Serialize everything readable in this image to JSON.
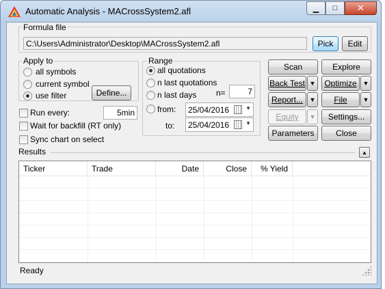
{
  "window": {
    "title": "Automatic Analysis - MACrossSystem2.afl"
  },
  "formula": {
    "group_label": "Formula file",
    "path": "C:\\Users\\Administrator\\Desktop\\MACrossSystem2.afl",
    "pick_label": "Pick",
    "edit_label": "Edit"
  },
  "apply_to": {
    "group_label": "Apply to",
    "options": [
      "all symbols",
      "current symbol",
      "use filter"
    ],
    "selected": "use filter",
    "define_label": "Define..."
  },
  "range": {
    "group_label": "Range",
    "options": [
      "all quotations",
      "n last quotations",
      "n last days",
      "from:"
    ],
    "selected": "all quotations",
    "n_label": "n=",
    "n_value": "7",
    "to_label": "to:",
    "from_date": "25/04/2016",
    "to_date": "25/04/2016"
  },
  "options": {
    "run_every_label": "Run every:",
    "run_every_value": "5min",
    "wait_backfill_label": "Wait for backfill (RT only)",
    "sync_chart_label": "Sync chart on select"
  },
  "actions": {
    "scan": "Scan",
    "explore": "Explore",
    "back_test": "Back Test",
    "optimize": "Optimize",
    "report": "Report...",
    "file": "File",
    "equity": "Equity",
    "settings": "Settings...",
    "parameters": "Parameters",
    "close": "Close"
  },
  "results": {
    "label": "Results",
    "columns": [
      "Ticker",
      "Trade",
      "Date",
      "Close",
      "% Yield"
    ]
  },
  "status": {
    "text": "Ready"
  },
  "colors": {
    "accent": "#3c7fb1",
    "window_frame": "#b9d1ea",
    "client_bg": "#f0f0f0",
    "close_button": "#c8452c"
  }
}
